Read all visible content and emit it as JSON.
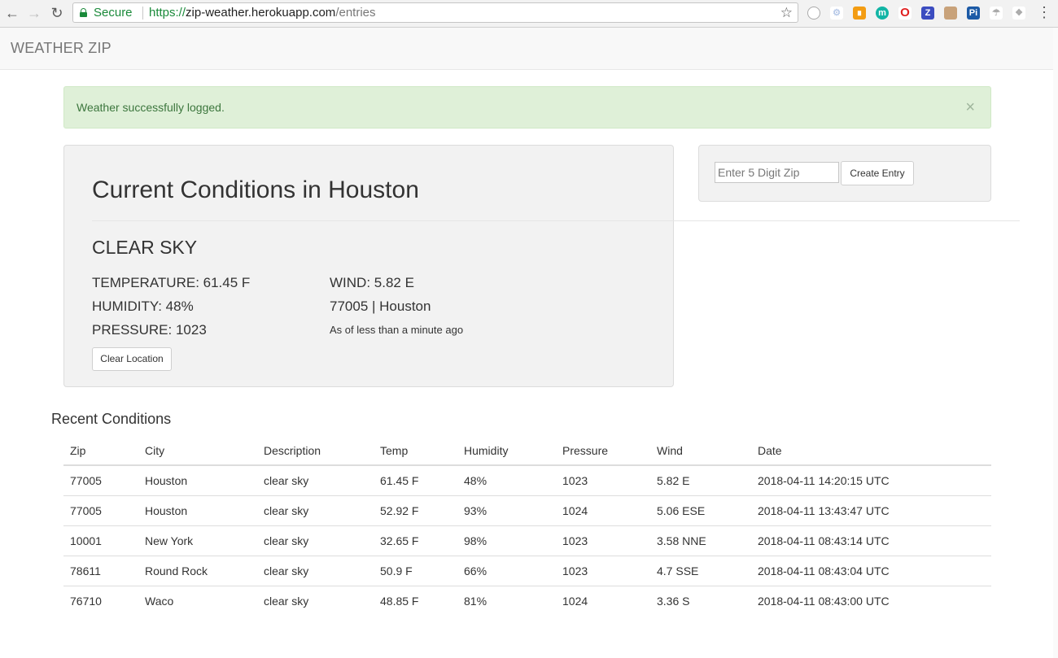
{
  "browser": {
    "secure_label": "Secure",
    "url_scheme": "https://",
    "url_host": "zip-weather.herokuapp.com",
    "url_path": "/entries"
  },
  "navbar": {
    "brand": "WEATHER ZIP"
  },
  "alert": {
    "message": "Weather successfully logged.",
    "close_symbol": "×"
  },
  "current": {
    "title": "Current Conditions in Houston",
    "description": "CLEAR SKY",
    "temperature": "TEMPERATURE: 61.45 F",
    "humidity": "HUMIDITY: 48%",
    "pressure": "PRESSURE: 1023",
    "wind": "WIND: 5.82 E",
    "location": "77005 | Houston",
    "as_of": "As of less than a minute ago",
    "clear_button": "Clear Location"
  },
  "zip_form": {
    "placeholder": "Enter 5 Digit Zip",
    "submit_label": "Create Entry"
  },
  "recent": {
    "title": "Recent Conditions",
    "columns": [
      "Zip",
      "City",
      "Description",
      "Temp",
      "Humidity",
      "Pressure",
      "Wind",
      "Date"
    ],
    "rows": [
      [
        "77005",
        "Houston",
        "clear sky",
        "61.45 F",
        "48%",
        "1023",
        "5.82 E",
        "2018-04-11 14:20:15 UTC"
      ],
      [
        "77005",
        "Houston",
        "clear sky",
        "52.92 F",
        "93%",
        "1024",
        "5.06 ESE",
        "2018-04-11 13:43:47 UTC"
      ],
      [
        "10001",
        "New York",
        "clear sky",
        "32.65 F",
        "98%",
        "1023",
        "3.58 NNE",
        "2018-04-11 08:43:14 UTC"
      ],
      [
        "78611",
        "Round Rock",
        "clear sky",
        "50.9 F",
        "66%",
        "1023",
        "4.7 SSE",
        "2018-04-11 08:43:04 UTC"
      ],
      [
        "76710",
        "Waco",
        "clear sky",
        "48.85 F",
        "81%",
        "1024",
        "3.36 S",
        "2018-04-11 08:43:00 UTC"
      ]
    ]
  }
}
